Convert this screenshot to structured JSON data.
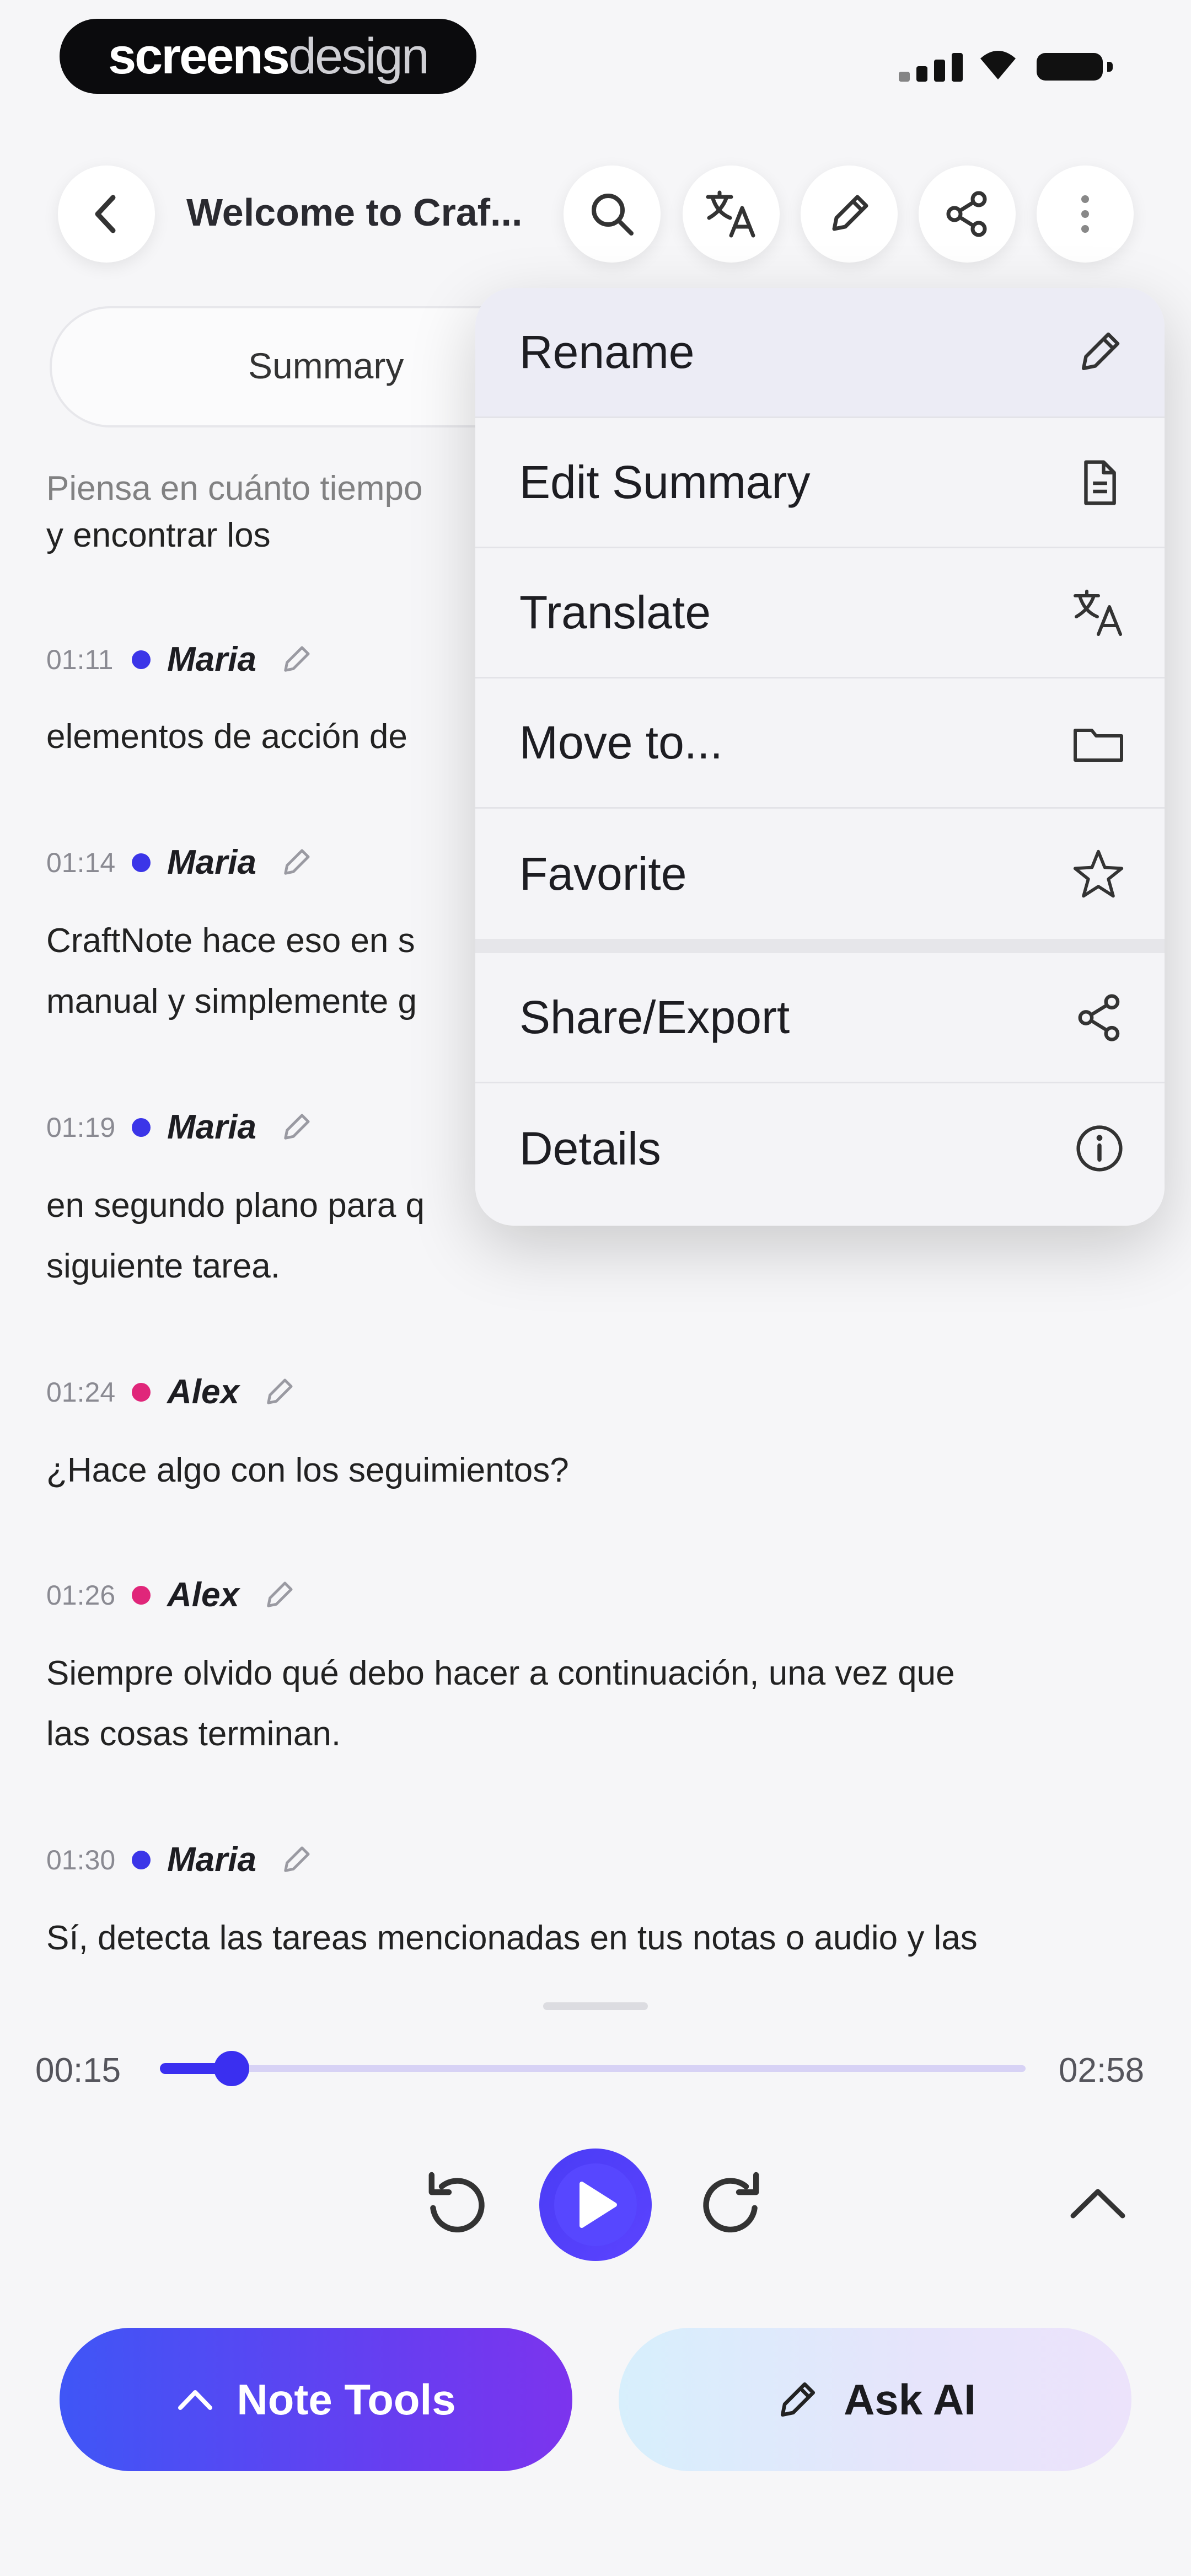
{
  "status_bar": {
    "brand_bold": "screens",
    "brand_light": "design"
  },
  "header": {
    "title": "Welcome to Craf..."
  },
  "tabs": {
    "summary_label": "Summary"
  },
  "transcript": {
    "partial_line_top": "Piensa en cuánto tiempo",
    "partial_line_2": "y encontrar los",
    "entries": [
      {
        "time": "01:11",
        "speaker": "Maria",
        "lines": [
          "elementos de acción de"
        ]
      },
      {
        "time": "01:14",
        "speaker": "Maria",
        "lines": [
          "CraftNote hace eso en s",
          "manual y simplemente g"
        ]
      },
      {
        "time": "01:19",
        "speaker": "Maria",
        "lines": [
          "en segundo plano para q",
          "siguiente tarea."
        ]
      },
      {
        "time": "01:24",
        "speaker": "Alex",
        "lines": [
          "¿Hace algo con los seguimientos?"
        ]
      },
      {
        "time": "01:26",
        "speaker": "Alex",
        "lines": [
          "Siempre olvido qué debo hacer a continuación, una vez que",
          "las cosas terminan."
        ]
      },
      {
        "time": "01:30",
        "speaker": "Maria",
        "lines": [
          "Sí, detecta las tareas mencionadas en tus notas o audio y las"
        ]
      }
    ]
  },
  "menu": {
    "items": [
      {
        "label": "Rename",
        "icon": "pencil-icon"
      },
      {
        "label": "Edit Summary",
        "icon": "document-icon"
      },
      {
        "label": "Translate",
        "icon": "translate-icon"
      },
      {
        "label": "Move to...",
        "icon": "folder-icon"
      },
      {
        "label": "Favorite",
        "icon": "star-icon"
      },
      {
        "label": "Share/Export",
        "icon": "share-icon"
      },
      {
        "label": "Details",
        "icon": "info-icon"
      }
    ]
  },
  "player": {
    "current_time": "00:15",
    "total_time": "02:58",
    "progress": 0.084
  },
  "actions": {
    "note_tools_label": "Note Tools",
    "ask_ai_label": "Ask AI"
  },
  "colors": {
    "accent": "#3a2ff0",
    "maria_dot": "#3b35e8",
    "alex_dot": "#e0267a"
  }
}
